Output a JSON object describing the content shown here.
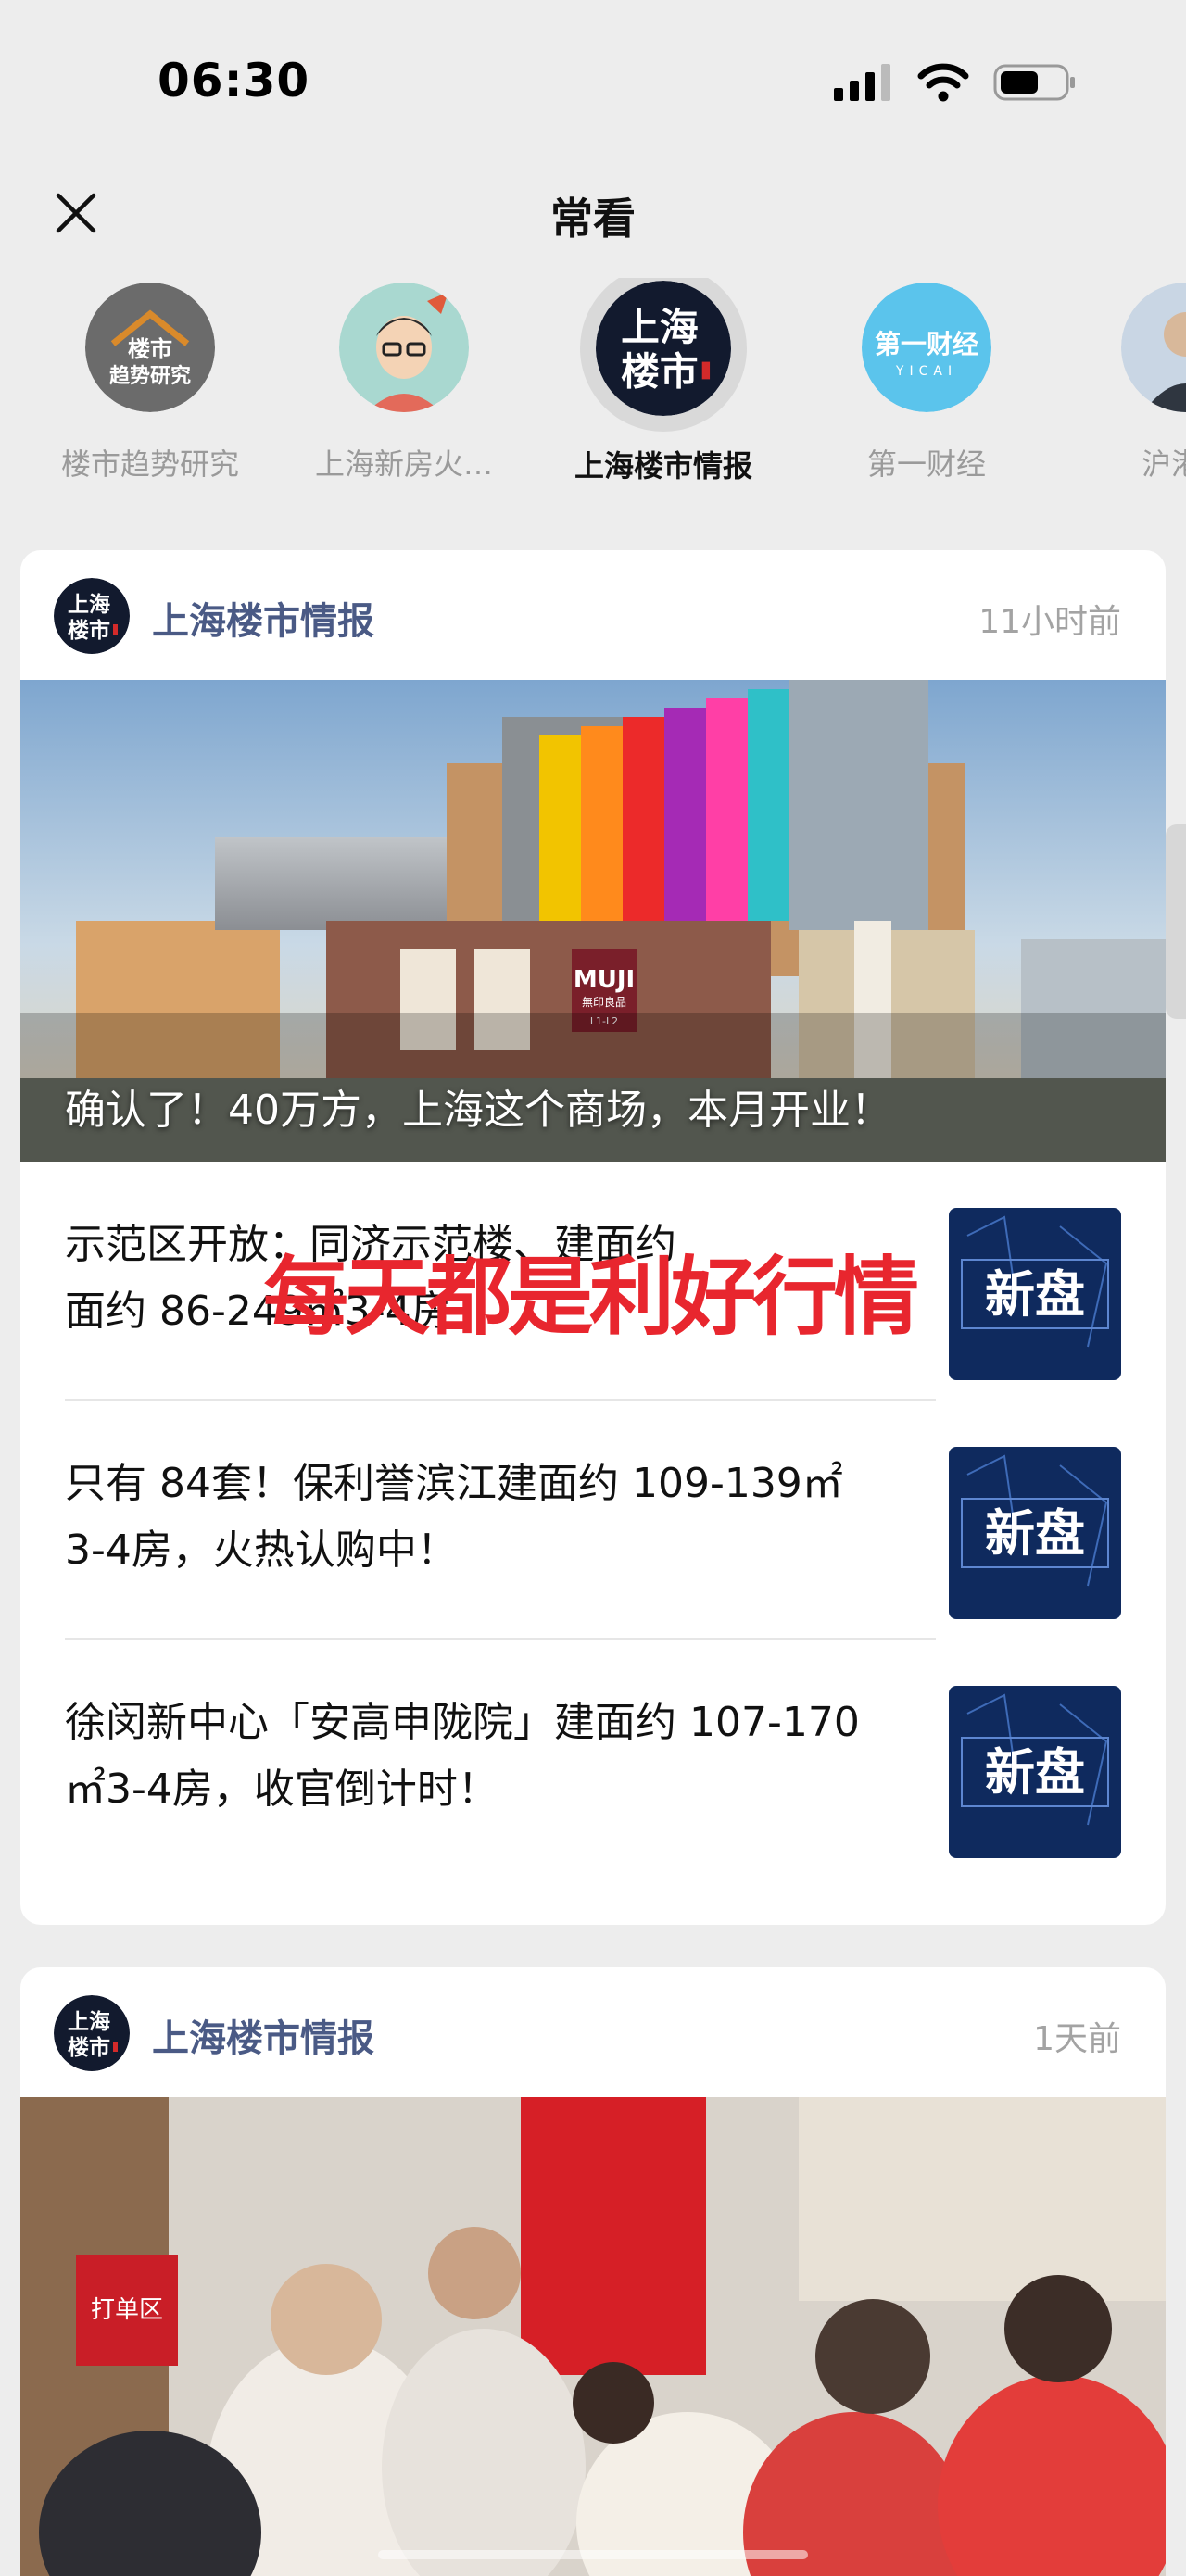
{
  "status_bar": {
    "time": "06:30"
  },
  "header": {
    "title": "常看"
  },
  "accounts": [
    {
      "name": "楼市趋势研究",
      "avatar_text": "楼市\n趋势研究",
      "active": false
    },
    {
      "name": "上海新房火…",
      "avatar_text": "",
      "active": false
    },
    {
      "name": "上海楼市情报",
      "avatar_text": "上海\n楼市",
      "active": true
    },
    {
      "name": "第一财经",
      "avatar_text": "第一财经",
      "avatar_sub": "YICAI",
      "active": false
    },
    {
      "name": "沪港纟",
      "avatar_text": "",
      "active": false
    }
  ],
  "cards": [
    {
      "source": "上海楼市情报",
      "time": "11小时前",
      "logo_text": "上海\n楼市",
      "hero_title": "确认了！40万方，上海这个商场，本月开业！",
      "hero_signs": {
        "brand": "MUJI",
        "brand_sub": "無印良品",
        "floor": "L1-L2"
      },
      "articles": [
        {
          "line1": "示范区开放：同济示范楼、建面约",
          "line2": "面约 86-249㎡3-4房",
          "thumb": "新盘"
        },
        {
          "line1": "只有 84套！保利誉滨江建面约 109-139㎡",
          "line2": "3-4房，火热认购中！",
          "thumb": "新盘"
        },
        {
          "line1": "徐闵新中心「安高申陇院」建面约 107-170",
          "line2": "㎡3-4房，收官倒计时！",
          "thumb": "新盘"
        }
      ]
    },
    {
      "source": "上海楼市情报",
      "time": "1天前",
      "logo_text": "上海\n楼市",
      "hero_signs": {
        "sign": "打单区"
      }
    }
  ],
  "overlay": {
    "text": "每天都是利好行情"
  },
  "colors": {
    "accent_source": "#4a5a85",
    "overlay_red": "#e8262e",
    "background": "#ededed"
  }
}
